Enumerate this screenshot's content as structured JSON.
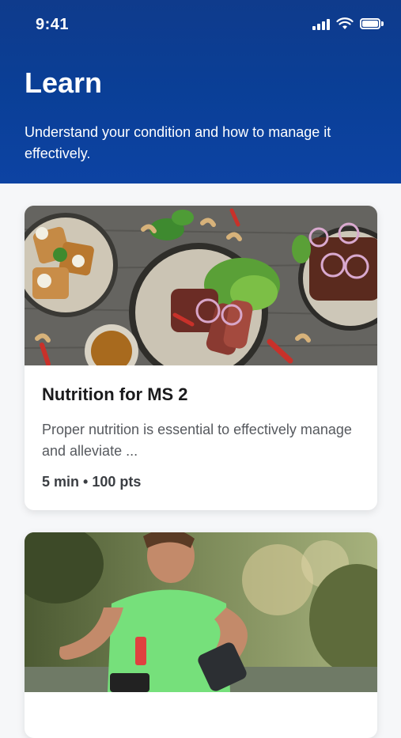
{
  "status": {
    "time": "9:41"
  },
  "header": {
    "title": "Learn",
    "subtitle": "Understand your condition and how to manage it effectively."
  },
  "cards": [
    {
      "title": "Nutrition for MS 2",
      "description": "Proper nutrition is essential to effectively manage and alleviate ...",
      "meta": "5 min • 100 pts",
      "image": "food-photo"
    },
    {
      "image": "runner-photo"
    }
  ],
  "colors": {
    "header": "#0d43a3",
    "background": "#f6f7f9",
    "card": "#ffffff"
  }
}
